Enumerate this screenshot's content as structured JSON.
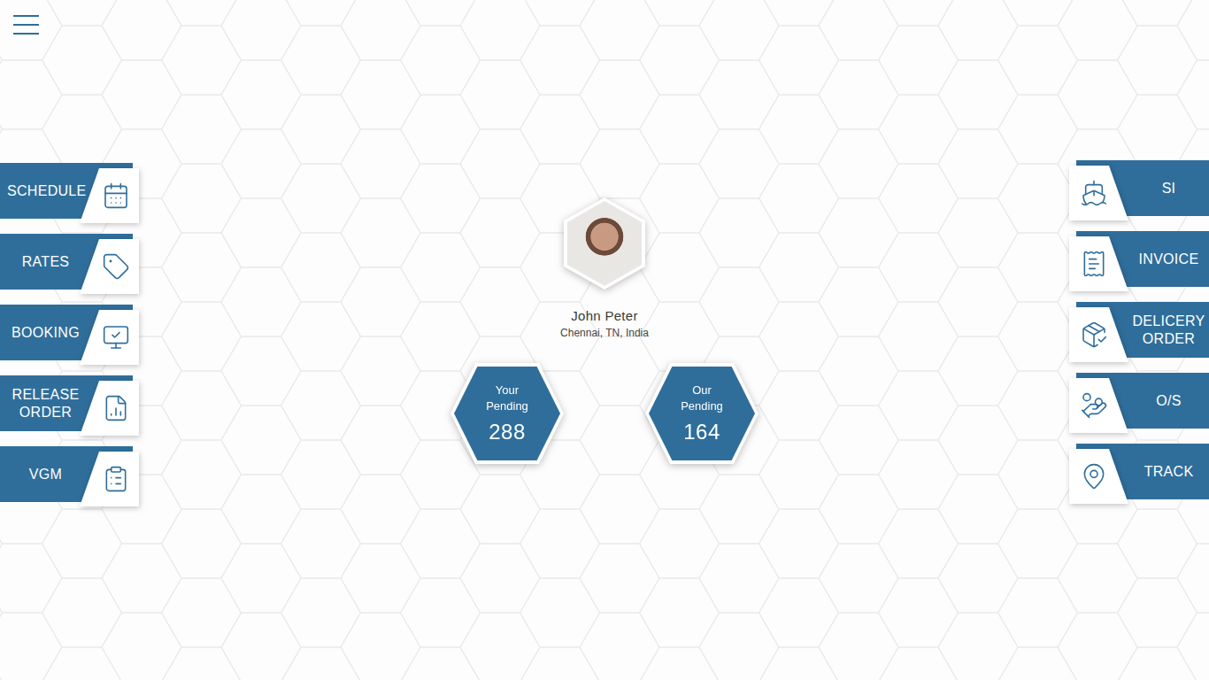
{
  "profile": {
    "name": "John Peter",
    "location": "Chennai, TN, India"
  },
  "pending": [
    {
      "label": "Your Pending",
      "count": "288"
    },
    {
      "label": "Our Pending",
      "count": "164"
    }
  ],
  "left_menu": [
    {
      "label": "SCHEDULE"
    },
    {
      "label": "RATES"
    },
    {
      "label": "BOOKING"
    },
    {
      "label": "RELEASE ORDER"
    },
    {
      "label": "VGM"
    }
  ],
  "right_menu": [
    {
      "label": "SI"
    },
    {
      "label": "INVOICE"
    },
    {
      "label": "DELICERY ORDER"
    },
    {
      "label": "O/S"
    },
    {
      "label": "TRACK"
    }
  ]
}
